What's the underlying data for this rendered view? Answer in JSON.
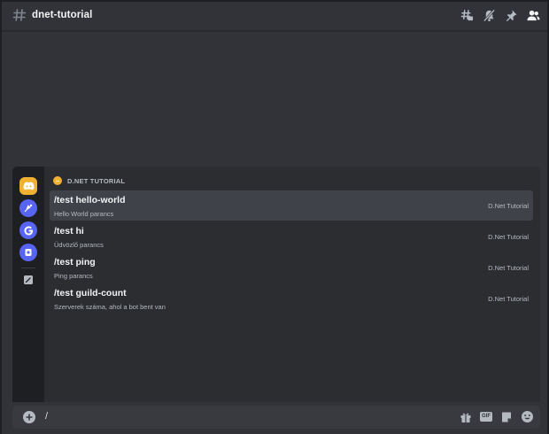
{
  "header": {
    "channel_name": "dnet-tutorial",
    "icons": [
      "threads-icon",
      "notifications-muted-icon",
      "pin-icon",
      "members-icon"
    ]
  },
  "popup": {
    "section_label": "D.NET TUTORIAL",
    "rail_icons": [
      "discord-icon",
      "bot-app-icon",
      "google-icon",
      "app-icon",
      "edit-icon"
    ],
    "commands": [
      {
        "name": "/test hello-world",
        "description": "Hello World parancs",
        "source": "D.Net Tutorial",
        "selected": true
      },
      {
        "name": "/test hi",
        "description": "Üdvözlő parancs",
        "source": "D.Net Tutorial",
        "selected": false
      },
      {
        "name": "/test ping",
        "description": "Ping parancs",
        "source": "D.Net Tutorial",
        "selected": false
      },
      {
        "name": "/test guild-count",
        "description": "Szerverek száma, ahol a bot bent van",
        "source": "D.Net Tutorial",
        "selected": false
      }
    ]
  },
  "input": {
    "value": "/",
    "icons": [
      "gift-icon",
      "gif-icon",
      "sticker-icon",
      "emoji-icon"
    ],
    "gif_label": "GIF"
  },
  "colors": {
    "background": "#313338",
    "popup": "#2b2d31",
    "rail": "#1e1f22",
    "selected_row": "#404249",
    "accent_orange": "#f0b132",
    "blurple": "#5865f2"
  }
}
